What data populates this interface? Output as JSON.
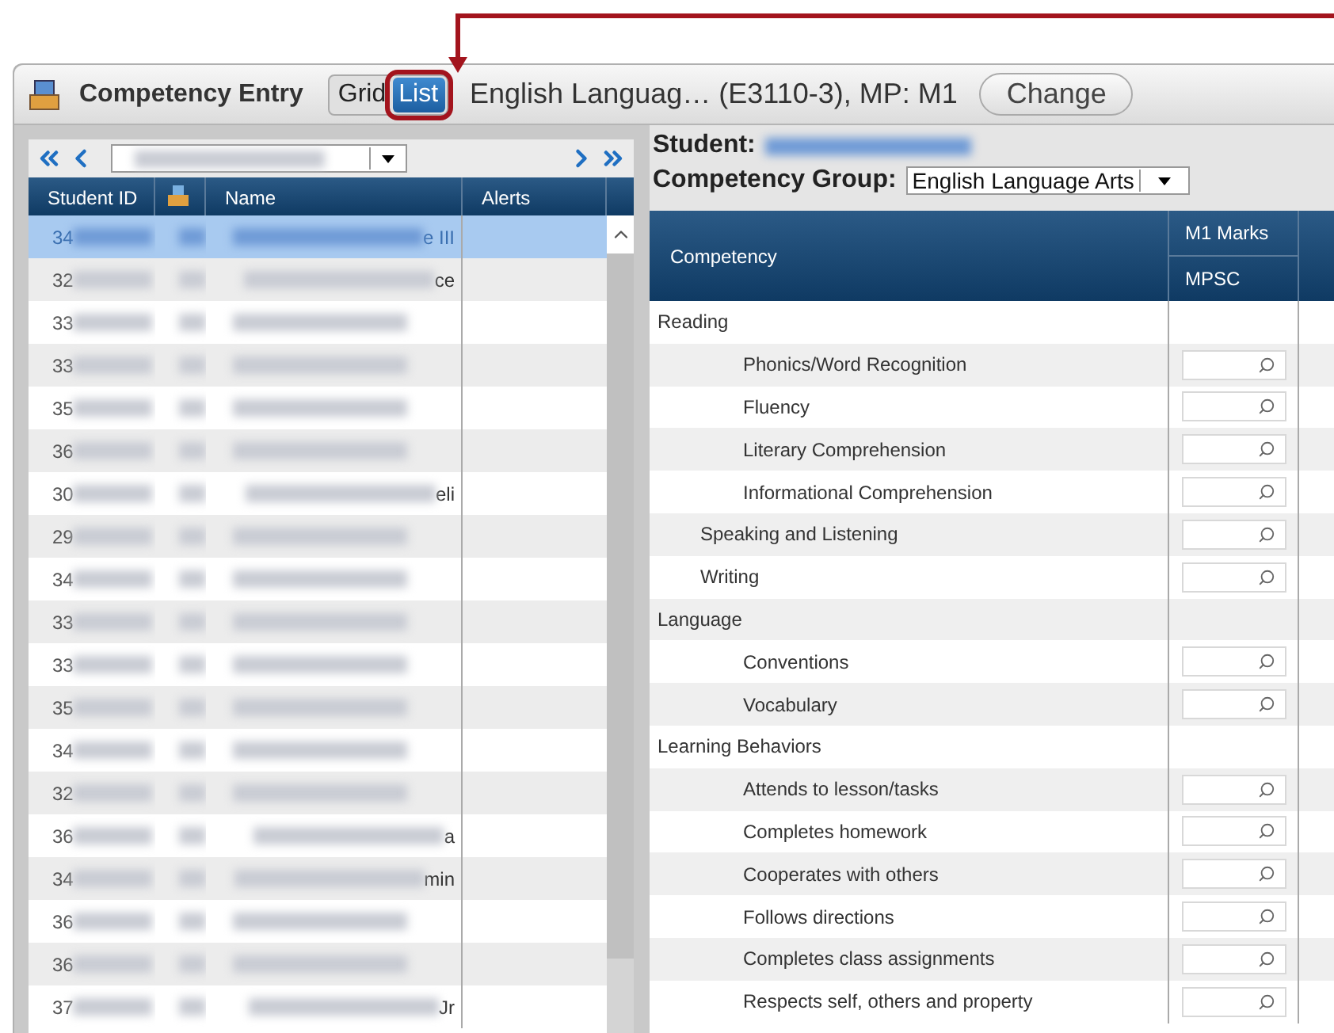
{
  "window": {
    "title": "Competency Entry"
  },
  "view_toggle": [
    {
      "label": "Grid",
      "selected": false,
      "highlighted": false
    },
    {
      "label": "List",
      "selected": true,
      "highlighted": true
    }
  ],
  "section": "English Languag… (E3110-3), MP: M1",
  "change_button": "Change",
  "student_list": {
    "columns": [
      "Student ID",
      "Name",
      "Alerts"
    ],
    "rows": [
      {
        "id": "34",
        "name": "e III",
        "selected": true
      },
      {
        "id": "32",
        "name": "ce",
        "selected": false
      },
      {
        "id": "33",
        "selected": false
      },
      {
        "id": "33",
        "selected": false
      },
      {
        "id": "35",
        "selected": false
      },
      {
        "id": "36",
        "selected": false
      },
      {
        "id": "30",
        "name": "eli",
        "selected": false
      },
      {
        "id": "29",
        "selected": false
      },
      {
        "id": "34",
        "selected": false
      },
      {
        "id": "33",
        "selected": false
      },
      {
        "id": "33",
        "selected": false
      },
      {
        "id": "35",
        "selected": false
      },
      {
        "id": "34",
        "selected": false
      },
      {
        "id": "32",
        "selected": false
      },
      {
        "id": "36",
        "name": "a",
        "selected": false
      },
      {
        "id": "34",
        "name": "min",
        "selected": false
      },
      {
        "id": "36",
        "selected": false
      },
      {
        "id": "36",
        "selected": false
      },
      {
        "id": "37",
        "name": "Jr",
        "selected": false
      }
    ]
  },
  "student": {
    "label": "Student:"
  },
  "competency_group": {
    "label": "Competency Group:",
    "value": "English Language Arts"
  },
  "table": {
    "competency_column": "Competency",
    "marks_column": "M1 Marks",
    "sub_column": "MPSC",
    "groups": [
      {
        "name": "Reading",
        "children": [
          {
            "name": "Phonics/Word Recognition",
            "kind": "standard"
          },
          {
            "name": "Fluency",
            "kind": "standard"
          },
          {
            "name": "Literary Comprehension",
            "kind": "standard"
          },
          {
            "name": "Informational Comprehension",
            "kind": "standard"
          },
          {
            "name": "Speaking and Listening",
            "kind": "strand"
          },
          {
            "name": "Writing",
            "kind": "strand"
          }
        ]
      },
      {
        "name": "Language",
        "children": [
          {
            "name": "Conventions",
            "kind": "standard"
          },
          {
            "name": "Vocabulary",
            "kind": "standard"
          }
        ]
      },
      {
        "name": "Learning Behaviors",
        "children": [
          {
            "name": "Attends to lesson/tasks",
            "kind": "standard"
          },
          {
            "name": "Completes homework",
            "kind": "standard"
          },
          {
            "name": "Cooperates with others",
            "kind": "standard"
          },
          {
            "name": "Follows directions",
            "kind": "standard"
          },
          {
            "name": "Completes class assignments",
            "kind": "standard"
          },
          {
            "name": "Respects self, others and property",
            "kind": "standard"
          }
        ]
      }
    ]
  }
}
